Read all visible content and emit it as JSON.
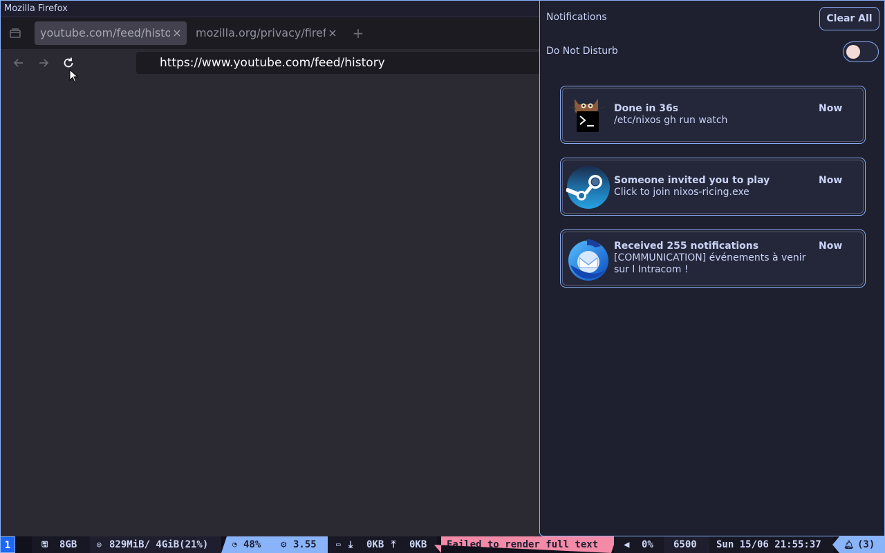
{
  "window": {
    "title": "Mozilla Firefox"
  },
  "tabs": [
    {
      "label": "youtube.com/feed/history",
      "active": true
    },
    {
      "label": "mozilla.org/privacy/firefox",
      "active": false
    }
  ],
  "urlbar": {
    "value": "https://www.youtube.com/feed/history"
  },
  "notifications_panel": {
    "title": "Notifications",
    "clear_all_label": "Clear All",
    "dnd_label": "Do Not Disturb",
    "dnd_enabled": false,
    "items": [
      {
        "icon": "terminal-cat-icon",
        "summary": "Done in 36s",
        "body": "/etc/nixos gh run watch",
        "time": "Now"
      },
      {
        "icon": "steam-icon",
        "summary": "Someone invited you to play",
        "body": "Click to join nixos-ricing.exe",
        "time": "Now"
      },
      {
        "icon": "thunderbird-icon",
        "summary": "Received 255 notifications",
        "body": "[COMMUNICATION] événements à venir sur l Intracom !",
        "time": "Now"
      }
    ]
  },
  "statusbar": {
    "workspace": "1",
    "disk": "8GB",
    "memory": "829MiB/ 4GiB(21%)",
    "cpu": "48%",
    "load": "3.55",
    "net_down": "0KB",
    "net_up": "0KB",
    "error_text": "Failed to render full text",
    "volume": "0%",
    "color_temp": "6500",
    "datetime": "Sun 15/06 21:55:37",
    "notif_count": "(3)"
  },
  "colors": {
    "accent": "#8aadf4",
    "panel_bg": "#1e2030",
    "error": "#f38ba8"
  }
}
